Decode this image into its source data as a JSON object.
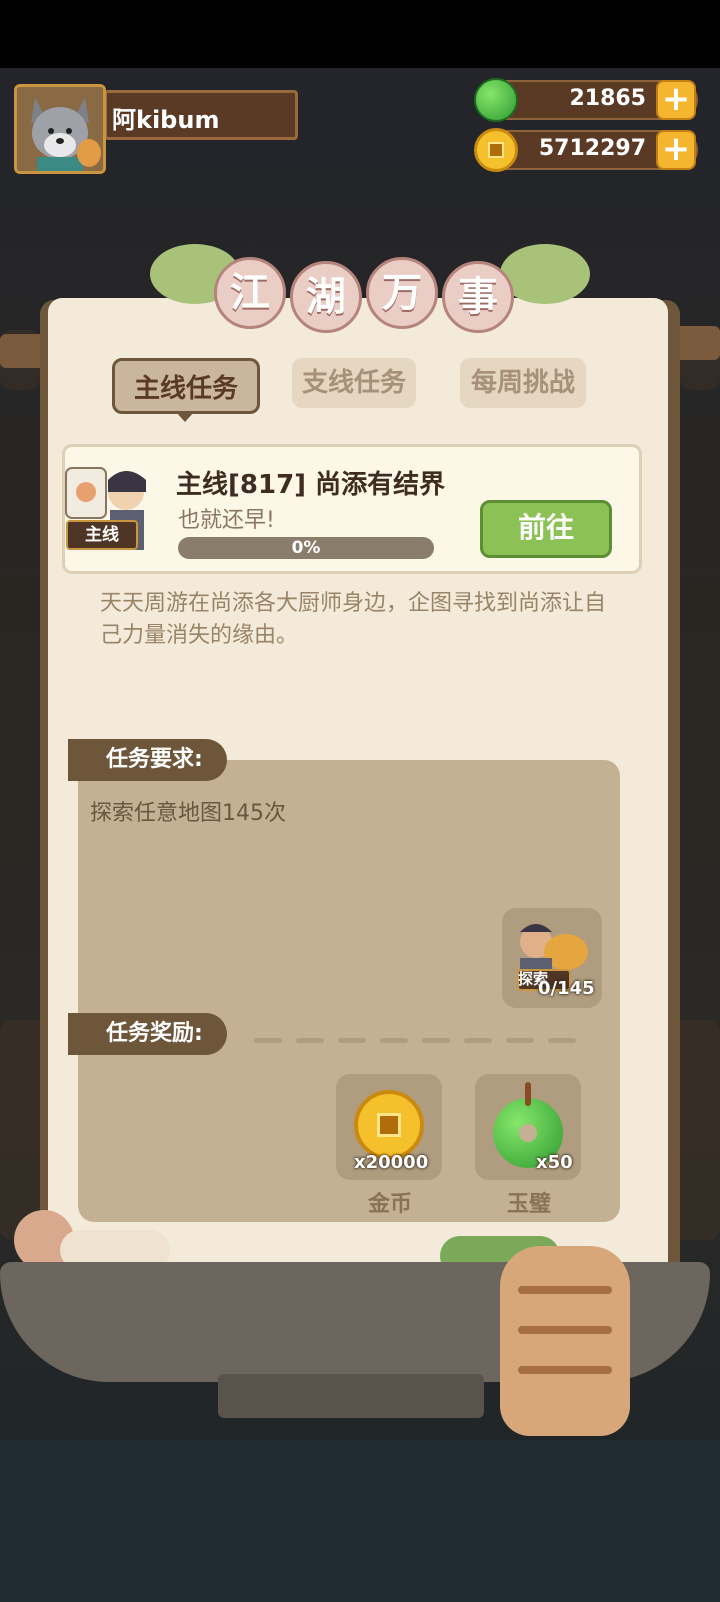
{
  "header": {
    "player_name": "阿kibum",
    "jade_currency": "21865",
    "gold_currency": "5712297"
  },
  "panel": {
    "title_chars": [
      "江",
      "湖",
      "万",
      "事"
    ]
  },
  "tabs": [
    {
      "label": "主线任务",
      "active": true
    },
    {
      "label": "支线任务",
      "active": false
    },
    {
      "label": "每周挑战",
      "active": false
    }
  ],
  "quest": {
    "badge": "主线",
    "title": "主线[817]  尚添有结界",
    "subtitle": "也就还早!",
    "progress_text": "0%",
    "progress": 0,
    "go_button": "前往",
    "description": "天天周游在尚添各大厨师身边，企图寻找到尚添让自己力量消失的缘由。"
  },
  "requirements": {
    "label": "任务要求:",
    "text": "探索任意地图145次",
    "item_badge": "探索",
    "item_count": "0/145"
  },
  "rewards": {
    "label": "任务奖励:",
    "items": [
      {
        "name": "金币",
        "count": "x20000",
        "icon": "gold-coin-icon"
      },
      {
        "name": "玉璧",
        "count": "x50",
        "icon": "jade-disc-icon"
      }
    ]
  },
  "colors": {
    "panel_bg": "#f3ead9",
    "tab_active": "#c9b69c",
    "go_button": "#8cc156",
    "section_label": "#6d5639"
  }
}
